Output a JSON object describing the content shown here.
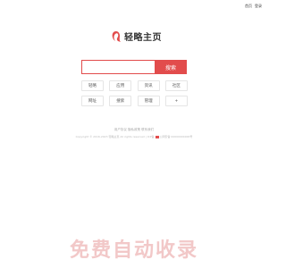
{
  "header": {
    "links": [
      "首页",
      "登录"
    ]
  },
  "logo": {
    "text": "轻略主页",
    "accent_color": "#e24c4c"
  },
  "search": {
    "placeholder": "",
    "button_label": "搜索"
  },
  "tiles": [
    {
      "label": "轻略"
    },
    {
      "label": "应用"
    },
    {
      "label": "资讯"
    },
    {
      "label": "社区"
    },
    {
      "label": "网址"
    },
    {
      "label": "搜索"
    },
    {
      "label": "管理"
    },
    {
      "label": "+",
      "icon": "plus-icon"
    }
  ],
  "footer": {
    "line1": "用户协议 隐私政策 联系我们",
    "line2_part1": "Copyright © 2016-2023 轻略主页 All rights reserved | ICP备",
    "line2_part2": "公网安备 00000000000号"
  },
  "banner": {
    "text": "免费自动收录"
  }
}
